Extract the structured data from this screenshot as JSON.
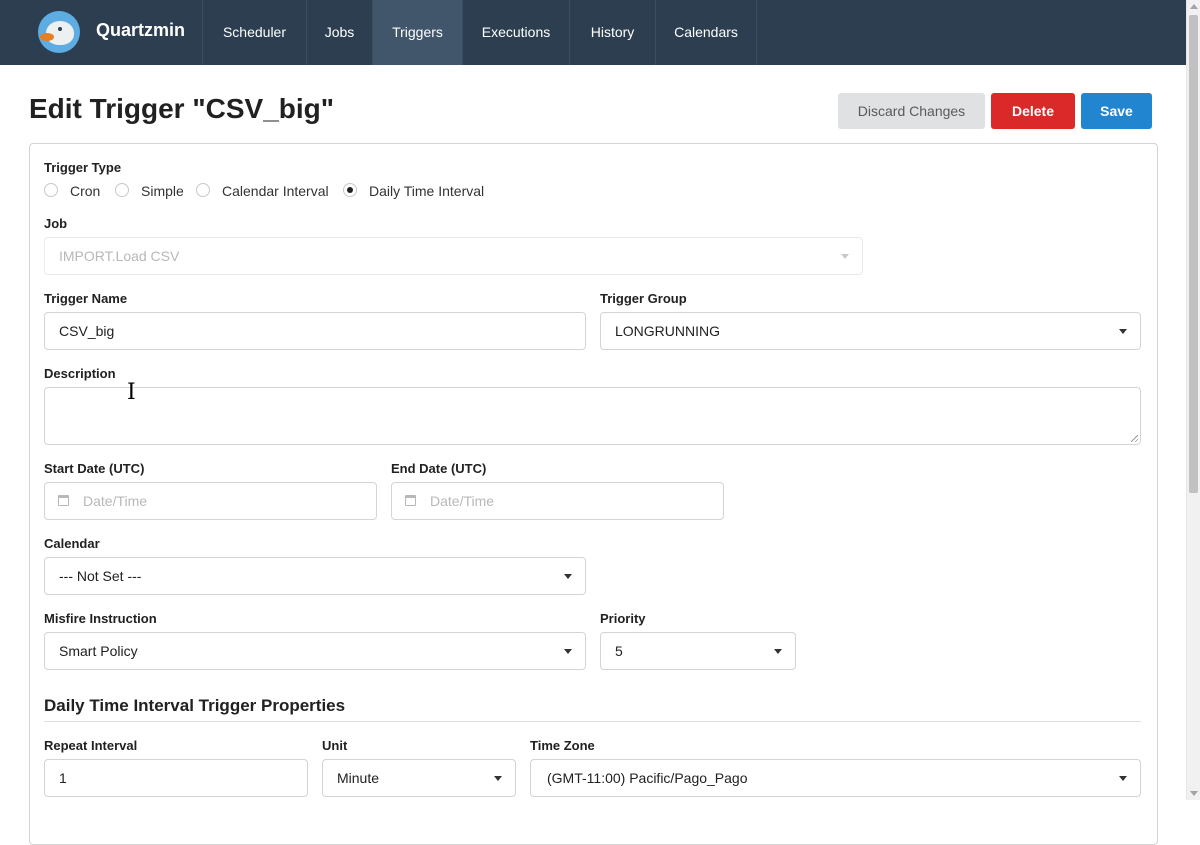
{
  "nav": {
    "brand": "Quartzmin",
    "items": [
      {
        "label": "Scheduler",
        "active": false
      },
      {
        "label": "Jobs",
        "active": false
      },
      {
        "label": "Triggers",
        "active": true
      },
      {
        "label": "Executions",
        "active": false
      },
      {
        "label": "History",
        "active": false
      },
      {
        "label": "Calendars",
        "active": false
      }
    ]
  },
  "header": {
    "title": "Edit Trigger \"CSV_big\"",
    "discard_label": "Discard Changes",
    "delete_label": "Delete",
    "save_label": "Save"
  },
  "form": {
    "trigger_type": {
      "label": "Trigger Type",
      "options": [
        "Cron",
        "Simple",
        "Calendar Interval",
        "Daily Time Interval"
      ],
      "selected": "Daily Time Interval"
    },
    "job": {
      "label": "Job",
      "value": "IMPORT.Load CSV"
    },
    "trigger_name": {
      "label": "Trigger Name",
      "value": "CSV_big"
    },
    "trigger_group": {
      "label": "Trigger Group",
      "value": "LONGRUNNING"
    },
    "description": {
      "label": "Description",
      "value": ""
    },
    "start_date": {
      "label": "Start Date (UTC)",
      "placeholder": "Date/Time"
    },
    "end_date": {
      "label": "End Date (UTC)",
      "placeholder": "Date/Time"
    },
    "calendar": {
      "label": "Calendar",
      "value": "--- Not Set ---"
    },
    "misfire": {
      "label": "Misfire Instruction",
      "value": "Smart Policy"
    },
    "priority": {
      "label": "Priority",
      "value": "5"
    }
  },
  "daily": {
    "section_title": "Daily Time Interval Trigger Properties",
    "repeat_interval": {
      "label": "Repeat Interval",
      "value": "1"
    },
    "unit": {
      "label": "Unit",
      "value": "Minute"
    },
    "time_zone": {
      "label": "Time Zone",
      "value": "(GMT-11:00) Pacific/Pago_Pago"
    }
  },
  "colors": {
    "navbar": "#2c3e50",
    "nav_active": "#41566b",
    "delete": "#db2828",
    "save": "#2185d0",
    "discard": "#e0e1e2"
  },
  "icons": [
    "quartzmin-logo",
    "calendar-icon",
    "chevron-down-icon",
    "text-cursor-icon"
  ]
}
